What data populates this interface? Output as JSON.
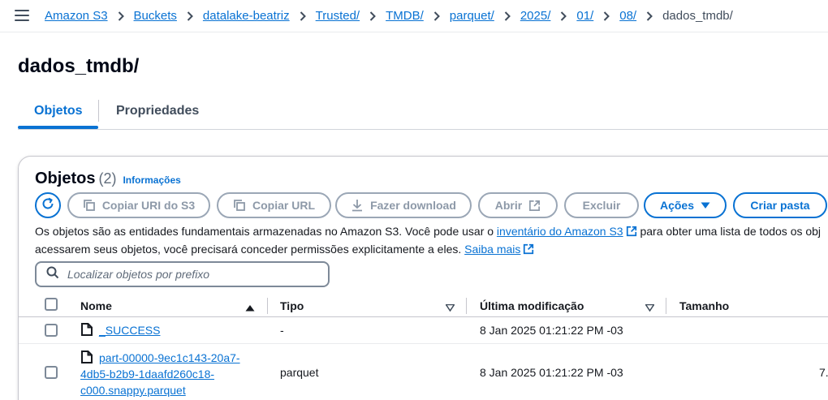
{
  "breadcrumbs": [
    {
      "label": "Amazon S3"
    },
    {
      "label": "Buckets"
    },
    {
      "label": "datalake-beatriz"
    },
    {
      "label": "Trusted/"
    },
    {
      "label": "TMDB/"
    },
    {
      "label": "parquet/"
    },
    {
      "label": "2025/"
    },
    {
      "label": "01/"
    },
    {
      "label": "08/"
    }
  ],
  "breadcrumb_current": "dados_tmdb/",
  "page_title": "dados_tmdb/",
  "tabs": [
    {
      "label": "Objetos",
      "active": true
    },
    {
      "label": "Propriedades",
      "active": false
    }
  ],
  "objects": {
    "title": "Objetos",
    "count": "(2)",
    "info_label": "Informações"
  },
  "toolbar": {
    "copy_uri": "Copiar URI do S3",
    "copy_url": "Copiar URL",
    "download": "Fazer download",
    "open": "Abrir",
    "delete": "Excluir",
    "actions": "Ações",
    "create_folder": "Criar pasta"
  },
  "description": {
    "part1": "Os objetos são as entidades fundamentais armazenadas no Amazon S3. Você pode usar o ",
    "inventory_link": "inventário do Amazon S3",
    "part2": " para obter uma lista de todos os obj",
    "part3": "acessarem seus objetos, você precisará conceder permissões explicitamente a eles. ",
    "learn_more": "Saiba mais"
  },
  "search": {
    "placeholder": "Localizar objetos por prefixo"
  },
  "table": {
    "columns": {
      "name": "Nome",
      "type": "Tipo",
      "modified": "Última modificação",
      "size": "Tamanho"
    },
    "rows": [
      {
        "name": "_SUCCESS",
        "type": "-",
        "modified": "8 Jan 2025 01:21:22 PM -03",
        "size": ""
      },
      {
        "name_lines": [
          "part-00000-9ec1c143-20a7-",
          "4db5-b2b9-1daafd260c18-",
          "c000.snappy.parquet"
        ],
        "type": "parquet",
        "modified": "8 Jan 2025 01:21:22 PM -03",
        "size": "7."
      }
    ]
  },
  "colors": {
    "accent": "#0972d3",
    "text": "#16191f",
    "disabled": "#8d99a8",
    "border": "#c6c6cd"
  },
  "icons": [
    "hamburger-icon",
    "chevron-right-icon",
    "refresh-icon",
    "copy-icon",
    "download-icon",
    "external-link-icon",
    "caret-down-icon",
    "search-icon",
    "file-icon",
    "sort-ascending-icon",
    "sort-descending-icon"
  ]
}
